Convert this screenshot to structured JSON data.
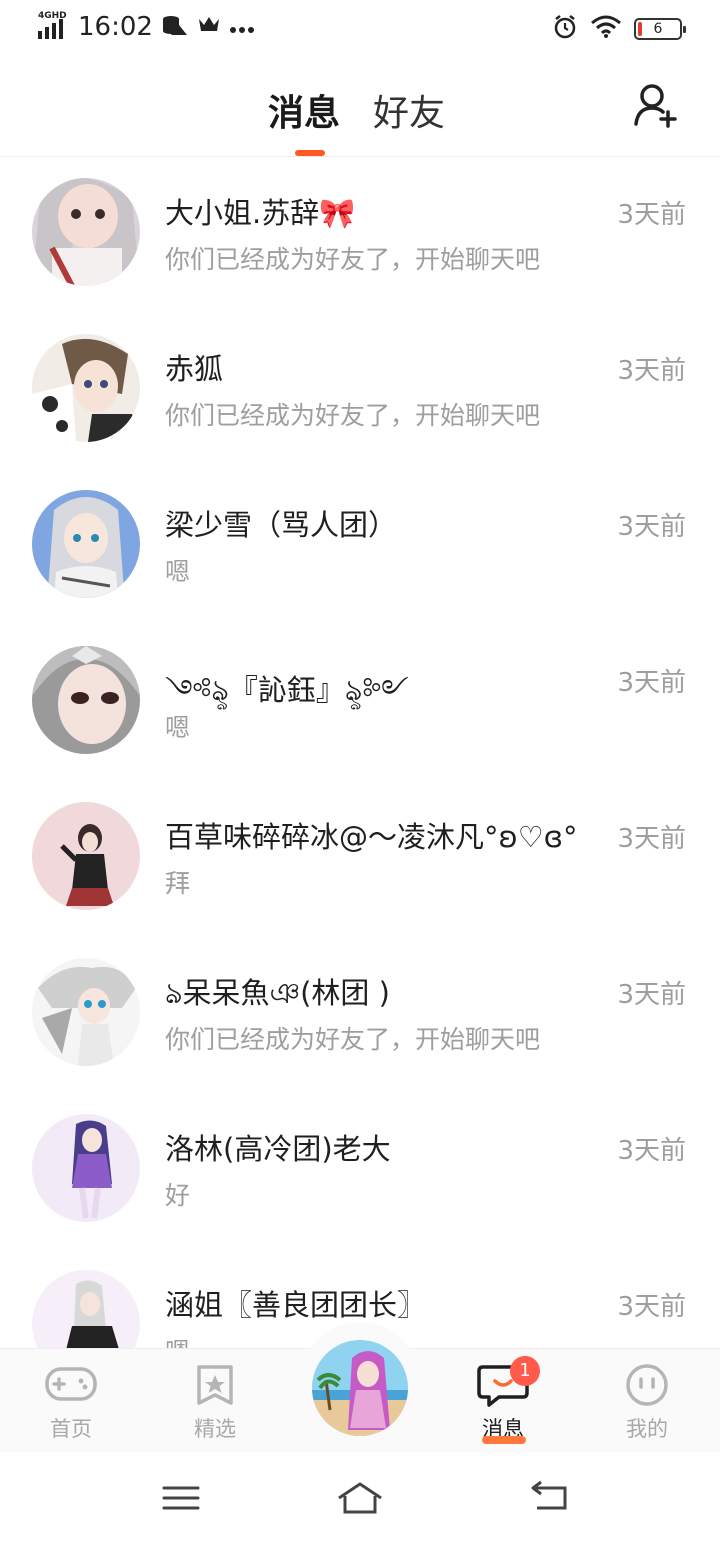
{
  "status_bar": {
    "network": "4GHD",
    "time": "16:02",
    "battery": "6"
  },
  "header": {
    "tab_messages": "消息",
    "tab_friends": "好友"
  },
  "conversations": [
    {
      "name": "大小姐.苏辞🎀",
      "time": "3天前",
      "preview": "你们已经成为好友了，开始聊天吧"
    },
    {
      "name": "赤狐",
      "time": "3天前",
      "preview": "你们已经成为好友了，开始聊天吧"
    },
    {
      "name": "梁少雪（骂人团）",
      "time": "3天前",
      "preview": "嗯"
    },
    {
      "name": "༺ৡ『訫鈺』ৡ༻",
      "time": "3天前",
      "preview": "嗯"
    },
    {
      "name": "百草味碎碎冰@～凌沐凡°ʚ♡ɞ°",
      "time": "3天前",
      "preview": "拜"
    },
    {
      "name": "ঌ呆呆魚ঞ(林团 )",
      "time": "3天前",
      "preview": "你们已经成为好友了，开始聊天吧"
    },
    {
      "name": "洛林(高冷团)老大",
      "time": "3天前",
      "preview": "好"
    },
    {
      "name": "涵姐〖善良团团长〗",
      "time": "3天前",
      "preview": "嗯"
    }
  ],
  "bottom_nav": {
    "home": "首页",
    "featured": "精选",
    "messages": "消息",
    "mine": "我的",
    "messages_badge": "1"
  },
  "colors": {
    "accent": "#ff5a1f",
    "badge": "#ff5a4a",
    "muted_text": "#9e9e9e"
  }
}
